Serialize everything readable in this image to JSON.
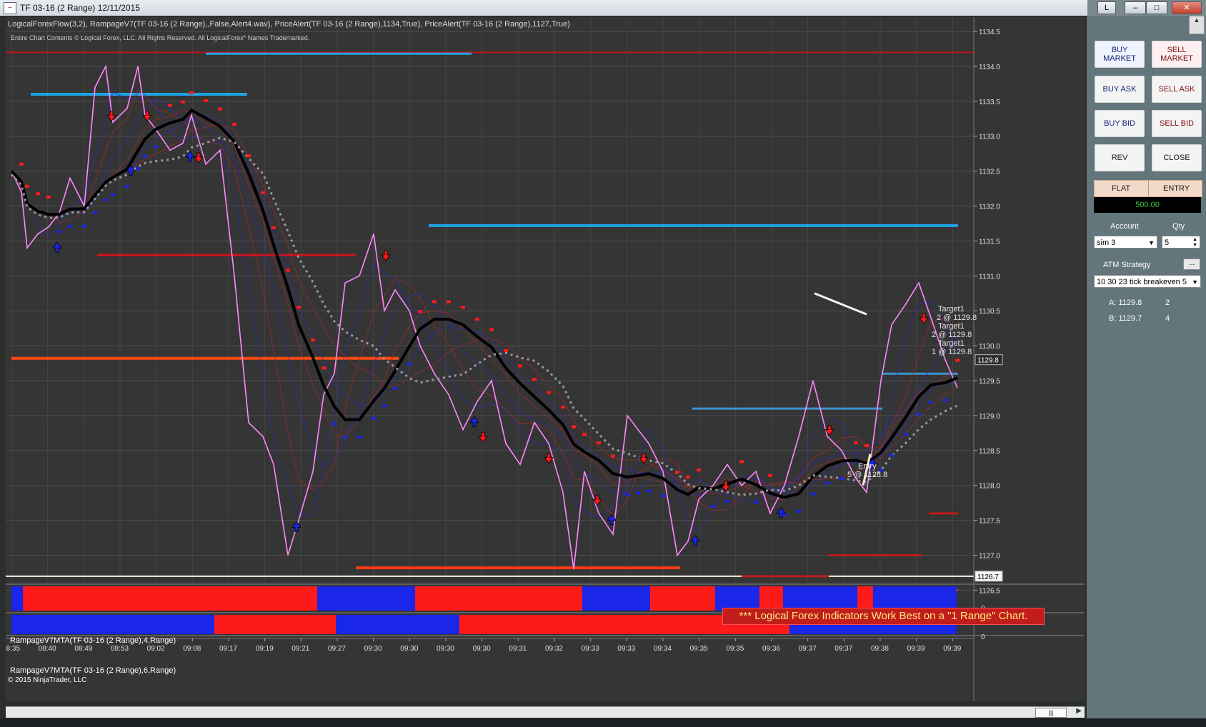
{
  "window": {
    "title": "TF 03-16 (2 Range)  12/11/2015",
    "controls": {
      "indicator": "L",
      "minimize": "–",
      "restore": "□",
      "close": "✕"
    }
  },
  "chart": {
    "indicators_line": "LogicalForexFlow(3,2),  RampageV7(TF 03-16 (2 Range),,False,Alert4.wav), PriceAlert(TF 03-16 (2 Range),1134,True), PriceAlert(TF 03-16 (2 Range),1127,True)",
    "copyright_line": "Entire Chart Contents © Logical Forex, LLC. All Rights Reserved. All LogicalForex* Names Trademarked.",
    "banner": "*** Logical Forex Indicators Work Best on a \"1 Range\" Chart.",
    "price_axis": [
      "1134.5",
      "1134.0",
      "1133.5",
      "1133.0",
      "1132.5",
      "1132.0",
      "1131.5",
      "1131.0",
      "1130.5",
      "1130.0",
      "1129.5",
      "1129.0",
      "1128.5",
      "1128.0",
      "1127.5",
      "1127.0",
      "1126.5"
    ],
    "price_markers": {
      "current": "1129.8",
      "alert": "1126.7"
    },
    "time_axis": [
      "08:35",
      "08:40",
      "08:49",
      "08:53",
      "09:02",
      "09:08",
      "09:17",
      "09:19",
      "09:21",
      "09:27",
      "09:30",
      "09:30",
      "09:30",
      "09:30",
      "09:31",
      "09:32",
      "09:33",
      "09:33",
      "09:34",
      "09:35",
      "09:35",
      "09:36",
      "09:37",
      "09:37",
      "09:38",
      "09:39",
      "09:39"
    ],
    "sub_panels": [
      {
        "label": "RampageV7MTA(TF 03-16 (2 Range),4,Range)",
        "zero": "0"
      },
      {
        "label": "RampageV7MTA(TF 03-16 (2 Range),6,Range)",
        "zero": "0"
      }
    ],
    "ninja_copyright": "© 2015 NinjaTrader, LLC",
    "annotations": {
      "target_a": "Target1",
      "target_a_qty": "2 @ 1129.8",
      "target_b": "Target1",
      "target_b_qty": "2 @ 1129.8",
      "target_c": "Target1",
      "target_c_qty": "1 @ 1129.8",
      "entry": "Entry",
      "entry_qty": "5 @ 1128.8"
    },
    "scroll_thumb": "|||"
  },
  "panel": {
    "buttons": {
      "buy_market": "BUY MARKET",
      "sell_market": "SELL MARKET",
      "buy_ask": "BUY ASK",
      "sell_ask": "SELL ASK",
      "buy_bid": "BUY BID",
      "sell_bid": "SELL BID",
      "rev": "REV",
      "close": "CLOSE"
    },
    "flat_label": "FLAT",
    "entry_label": "ENTRY",
    "pnl": "500.00",
    "account_label": "Account",
    "qty_label": "Qty",
    "account_value": "sim 3",
    "qty_value": "5",
    "atm_label": "ATM Strategy",
    "atm_more": "...",
    "atm_value": "10 30 23 tick breakeven 5",
    "ask_line": "A: 1129.8",
    "ask_qty": "2",
    "bid_line": "B: 1129.7",
    "bid_qty": "4"
  },
  "colors": {
    "bull": "#1a26e8",
    "bear": "#ff1a1a",
    "price": "#ff88ff",
    "avg": "#000000",
    "level": "#1fa3e3",
    "banner_text": "#ffe97a"
  }
}
